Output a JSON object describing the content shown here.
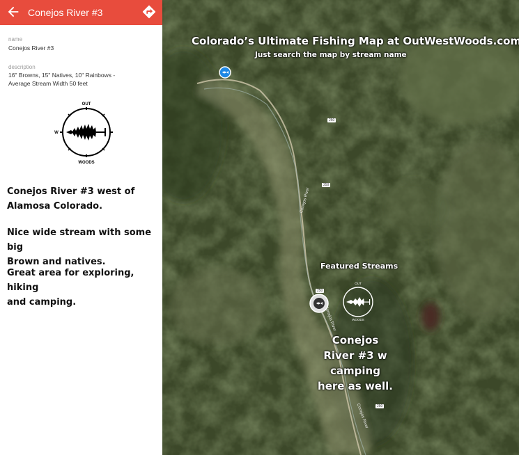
{
  "header": {
    "title": "Conejos River #3",
    "back_icon": "arrow-back-icon",
    "directions_icon": "directions-icon",
    "color": "#e84c3d"
  },
  "fields": {
    "name_label": "name",
    "name_value": "Conejos River #3",
    "description_label": "description",
    "description_line1": "16\" Browns, 15\" Natives, 10\" Rainbows -",
    "description_line2": "Average Stream Width 50 feet"
  },
  "compass": {
    "top": "OUT",
    "left": "W",
    "bottom": "WOODS"
  },
  "story": {
    "p1_line1": "Conejos River #3 west of",
    "p1_line2": "Alamosa Colorado.",
    "p2_line1": "Nice wide stream with some big",
    "p2_line2": "Brown and natives.",
    "p3_line1": "Great area for exploring, hiking",
    "p3_line2": "and camping."
  },
  "map": {
    "headline": "Colorado’s Ultimate Fishing Map at OutWestWoods.com",
    "subheadline": "Just search the map by stream name",
    "featured": "Featured Streams",
    "callout_line1": "Conejos",
    "callout_line2": "River #3 w",
    "callout_line3": "camping",
    "callout_line4": "here as well.",
    "highway_labels": [
      "250",
      "250",
      "250",
      "250"
    ],
    "river_labels": [
      "Conejos River",
      "Conejos River",
      "Conejos River"
    ],
    "compass_top": "OUT",
    "compass_bottom": "WOODS",
    "marker_icons": [
      "fish-marker-icon",
      "selected-marker-icon"
    ]
  }
}
